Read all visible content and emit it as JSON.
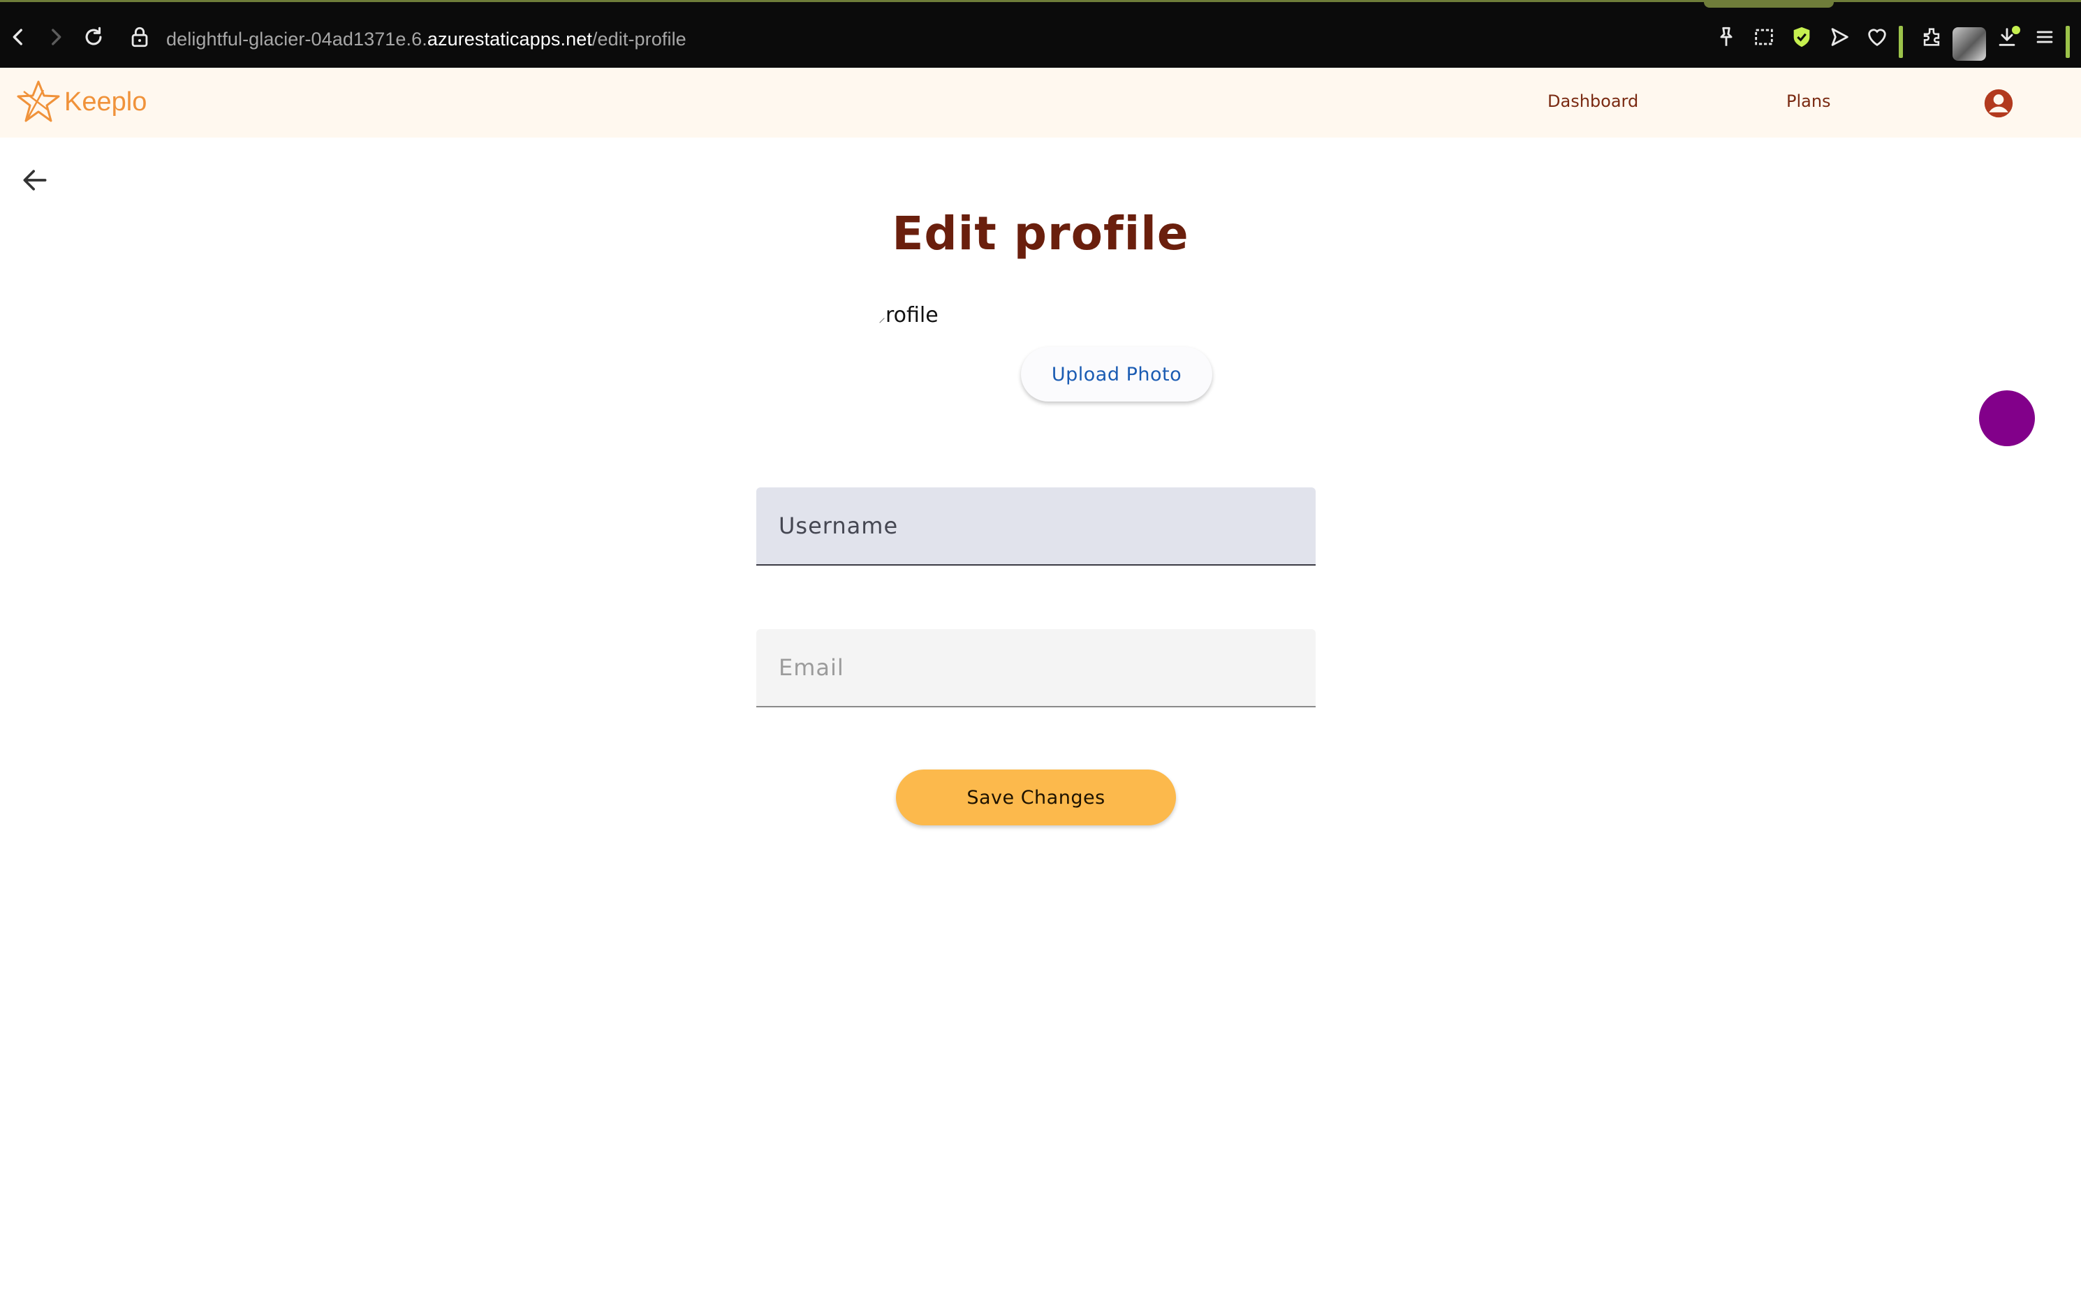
{
  "browser": {
    "url_prefix": "delightful-glacier-04ad1371e.6.",
    "url_domain": "azurestaticapps.net",
    "url_path": "/edit-profile",
    "accent_color": "#9cc34a"
  },
  "header": {
    "logo_text": "Keeplo",
    "nav": {
      "dashboard": "Dashboard",
      "plans": "Plans"
    },
    "brand_color": "#f0923a",
    "background": "#fff8ef"
  },
  "main": {
    "title": "Edit profile",
    "profile_image_alt": "rofile",
    "upload_button": "Upload Photo",
    "username_placeholder": "Username",
    "email_placeholder": "Email",
    "save_button": "Save Changes",
    "save_button_color": "#fcb94c",
    "fab_color": "#82008a"
  }
}
